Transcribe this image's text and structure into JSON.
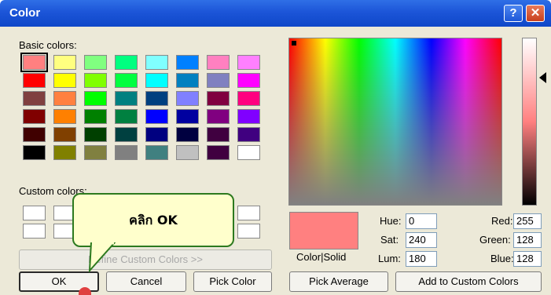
{
  "window": {
    "title": "Color",
    "help_label": "?",
    "close_label": "✕"
  },
  "basic_colors": {
    "label": "Basic colors:",
    "rows": [
      [
        "#ff8080",
        "#ffff80",
        "#80ff80",
        "#00ff80",
        "#80ffff",
        "#0080ff",
        "#ff80c0",
        "#ff80ff"
      ],
      [
        "#ff0000",
        "#ffff00",
        "#80ff00",
        "#00ff40",
        "#00ffff",
        "#0080c0",
        "#8080c0",
        "#ff00ff"
      ],
      [
        "#804040",
        "#ff8040",
        "#00ff00",
        "#008080",
        "#004080",
        "#8080ff",
        "#800040",
        "#ff0080"
      ],
      [
        "#800000",
        "#ff8000",
        "#008000",
        "#008040",
        "#0000ff",
        "#0000a0",
        "#800080",
        "#8000ff"
      ],
      [
        "#400000",
        "#804000",
        "#004000",
        "#004040",
        "#000080",
        "#000040",
        "#400040",
        "#400080"
      ],
      [
        "#000000",
        "#808000",
        "#808040",
        "#808080",
        "#408080",
        "#c0c0c0",
        "#400040",
        "#ffffff"
      ]
    ],
    "selected": "#ff8080"
  },
  "custom_colors": {
    "label": "Custom colors:"
  },
  "buttons": {
    "define_custom": "Define Custom Colors >>",
    "ok": "OK",
    "cancel": "Cancel",
    "pick_color": "Pick Color",
    "pick_average": "Pick Average",
    "add_custom": "Add to Custom Colors"
  },
  "preview": {
    "label": "Color|Solid",
    "color": "#ff8080"
  },
  "fields": {
    "hue": {
      "label": "Hue:",
      "value": "0"
    },
    "sat": {
      "label": "Sat:",
      "value": "240"
    },
    "lum": {
      "label": "Lum:",
      "value": "180"
    },
    "red": {
      "label": "Red:",
      "value": "255"
    },
    "green": {
      "label": "Green:",
      "value": "128"
    },
    "blue": {
      "label": "Blue:",
      "value": "128"
    }
  },
  "callout": {
    "text": "คลิก OK"
  }
}
